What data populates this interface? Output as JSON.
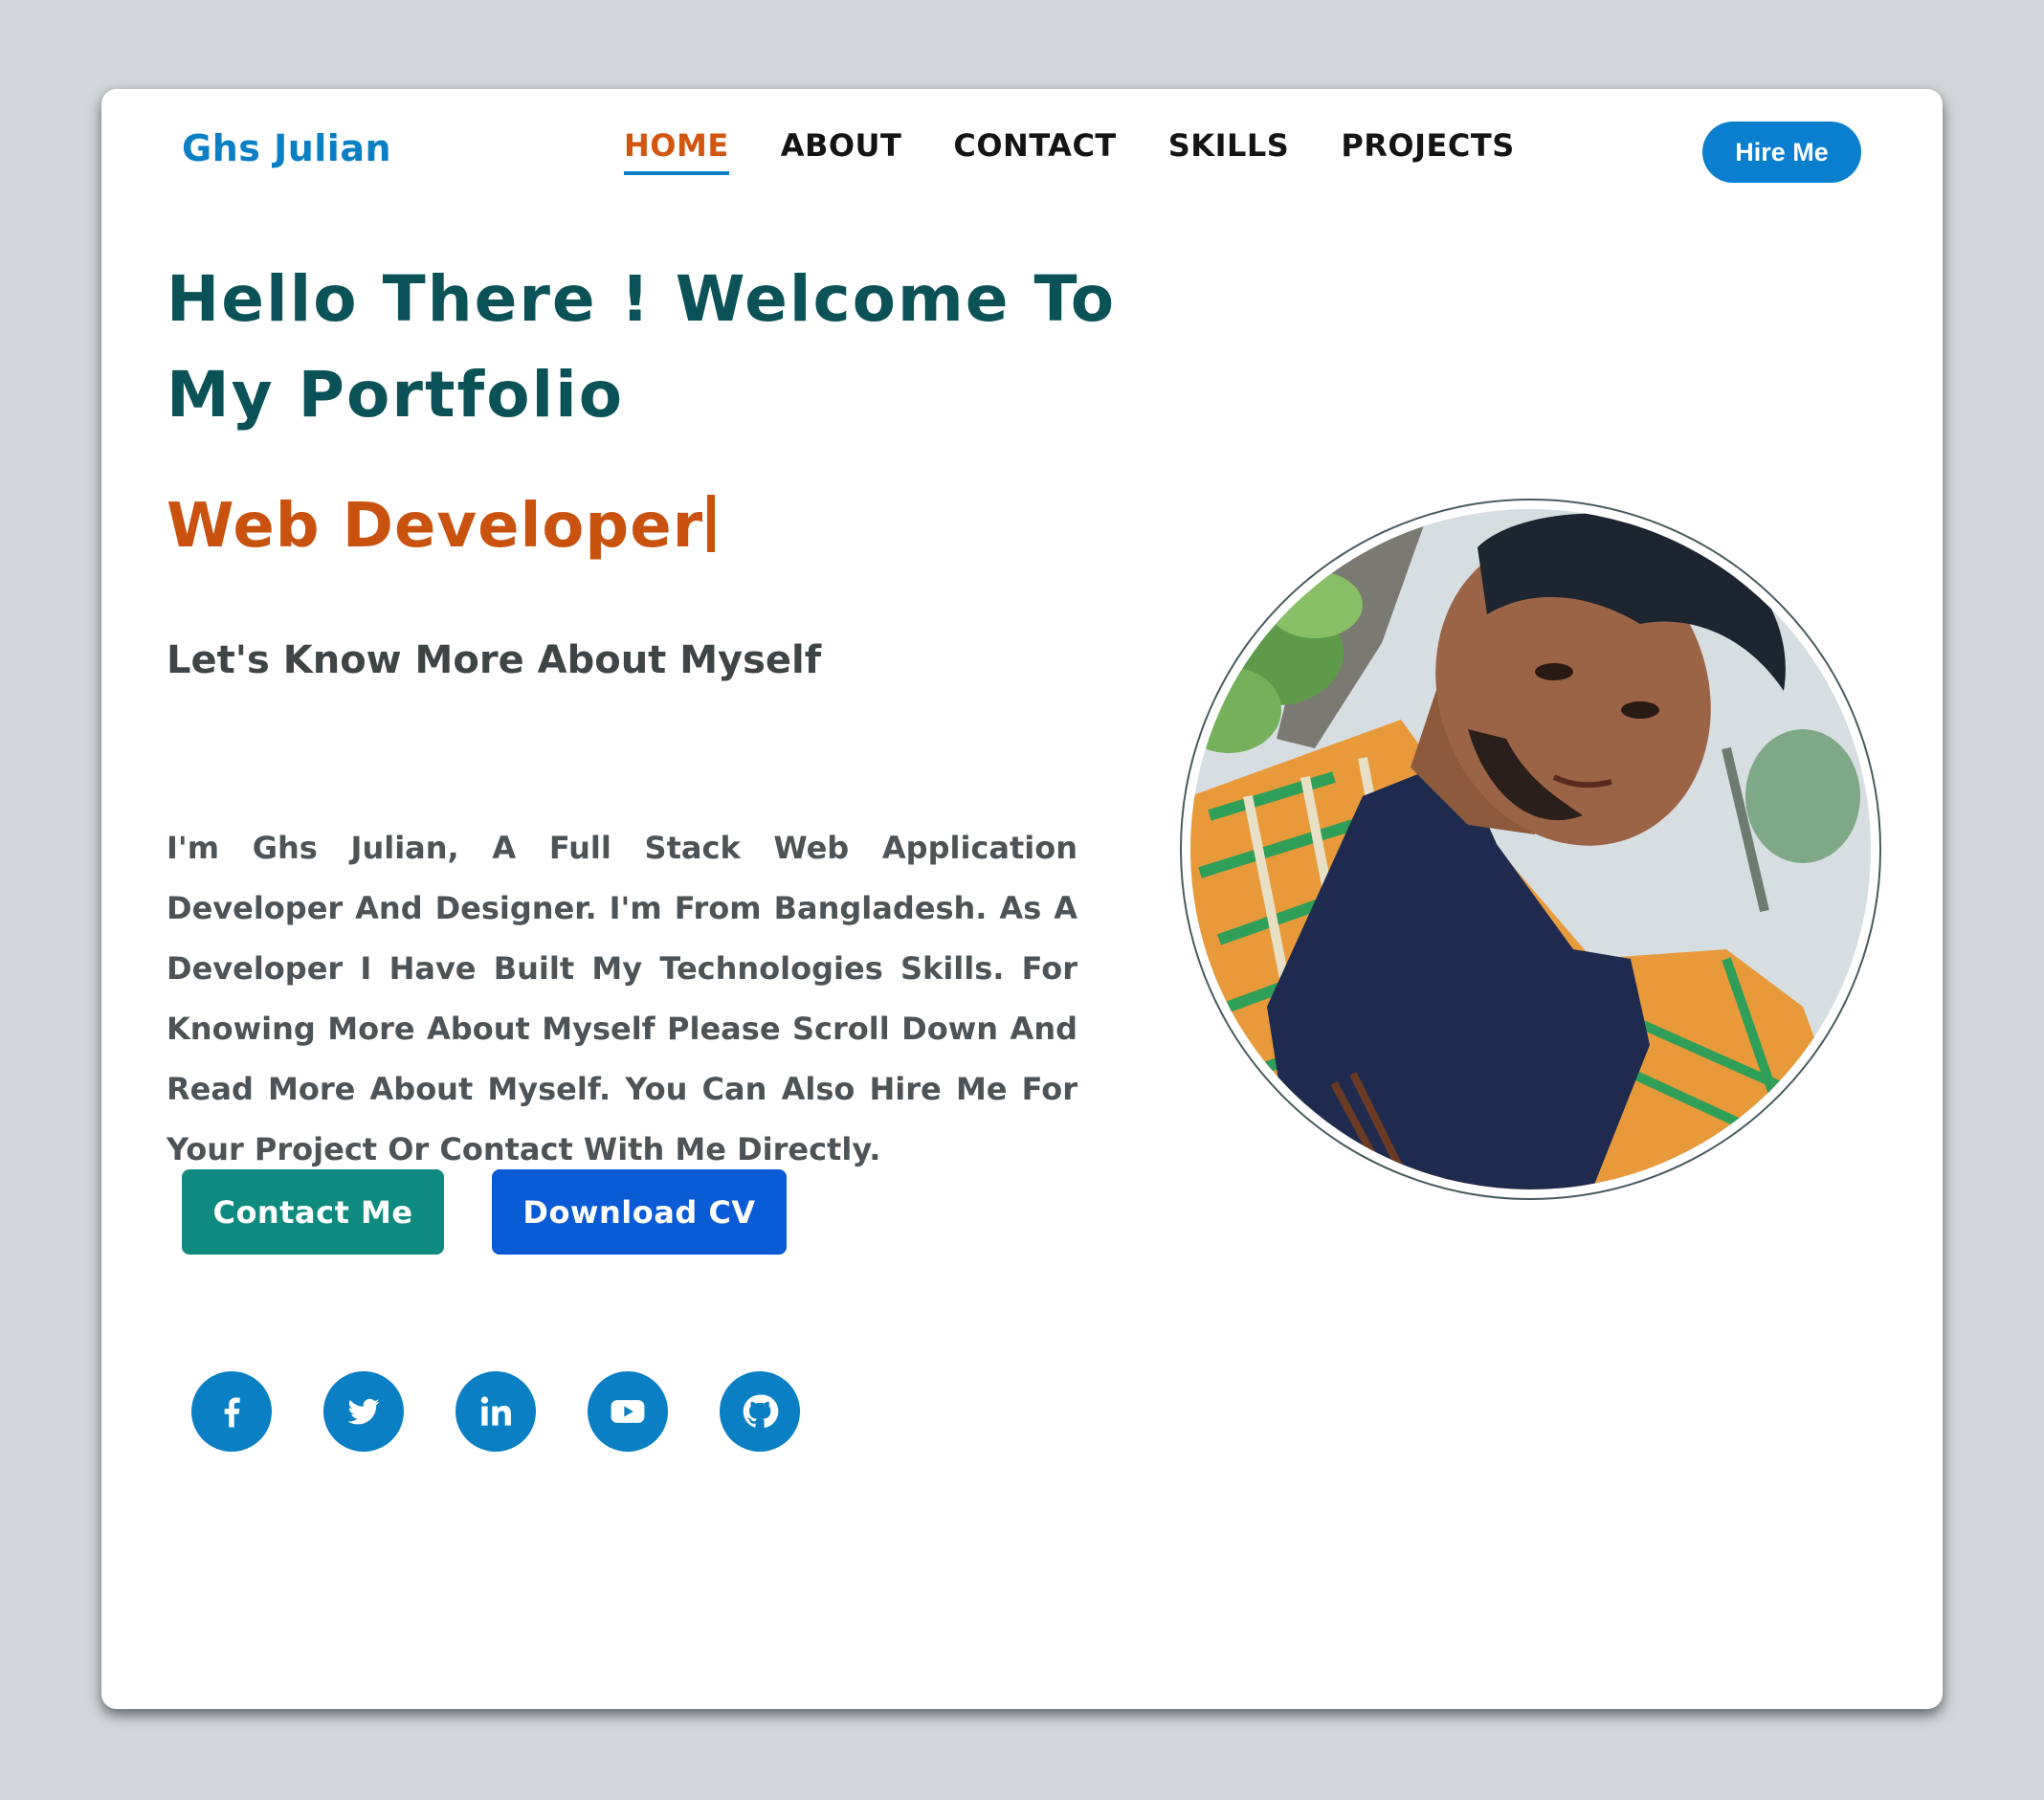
{
  "brand": {
    "name": "Ghs Julian"
  },
  "nav": {
    "items": [
      {
        "label": "HOME",
        "active": true
      },
      {
        "label": "ABOUT",
        "active": false
      },
      {
        "label": "CONTACT",
        "active": false
      },
      {
        "label": "SKILLS",
        "active": false
      },
      {
        "label": "PROJECTS",
        "active": false
      }
    ],
    "hire_label": "Hire Me"
  },
  "hero": {
    "title": "Hello There ! Welcome To My Portfolio",
    "role": "Web Developer",
    "subheading": "Let's Know More About Myself",
    "bio": "I'm Ghs Julian, A Full Stack Web Application Developer And Designer. I'm From Bangladesh. As A Developer I Have Built My Technologies Skills. For Knowing More About Myself Please Scroll Down And Read More About Myself. You Can Also Hire Me For Your Project Or Contact With Me Directly.",
    "contact_button": "Contact Me",
    "cv_button": "Download CV"
  },
  "socials": [
    {
      "icon": "facebook-icon"
    },
    {
      "icon": "twitter-icon"
    },
    {
      "icon": "linkedin-icon"
    },
    {
      "icon": "youtube-icon"
    },
    {
      "icon": "github-icon"
    }
  ],
  "colors": {
    "brand_blue": "#0a7fc4",
    "heading_teal": "#0b5258",
    "accent_orange": "#c9520f",
    "contact_button": "#0f8a80",
    "cv_button": "#0a5bd6",
    "background": "#d2d7da"
  }
}
